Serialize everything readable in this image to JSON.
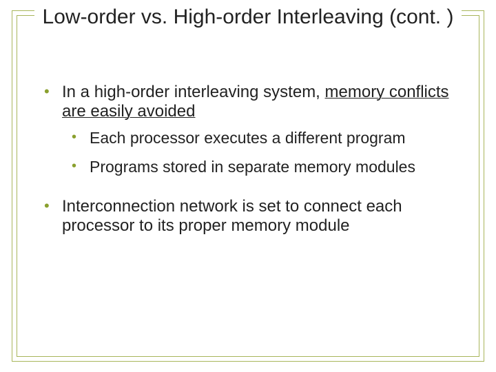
{
  "title": "Low-order vs. High-order Interleaving (cont. )",
  "bullets": [
    {
      "plain": "In a high-order interleaving system, ",
      "underline": "memory conflicts are easily avoided",
      "sub": [
        "Each processor executes a different program",
        "Programs stored in separate memory modules"
      ]
    },
    {
      "plain": "Interconnection network is set to connect each processor to its proper memory module",
      "underline": "",
      "sub": []
    }
  ]
}
